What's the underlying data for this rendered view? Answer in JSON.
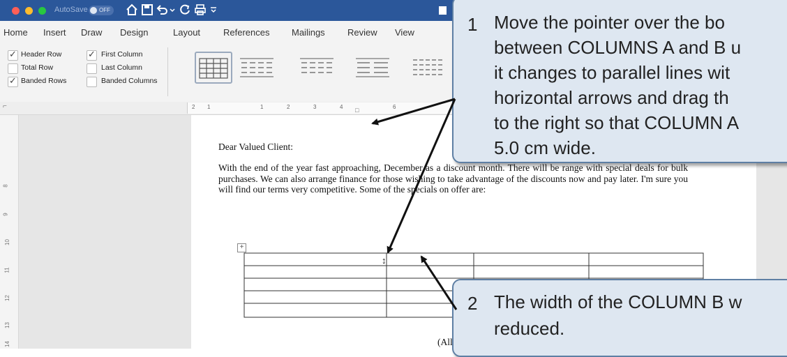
{
  "titlebar": {
    "autosave_label": "AutoSave",
    "autosave_state": "OFF"
  },
  "tabs": [
    "Home",
    "Insert",
    "Draw",
    "Design",
    "Layout",
    "References",
    "Mailings",
    "Review",
    "View"
  ],
  "options": {
    "header_row": "Header Row",
    "total_row": "Total Row",
    "banded_rows": "Banded Rows",
    "first_column": "First Column",
    "last_column": "Last Column",
    "banded_columns": "Banded Columns"
  },
  "ruler": {
    "numbers": [
      "2",
      "1",
      "1",
      "2",
      "3",
      "4",
      "6"
    ]
  },
  "vruler": {
    "numbers": [
      "8",
      "9",
      "10",
      "11",
      "12",
      "13",
      "14"
    ]
  },
  "document": {
    "salutation": "Dear Valued Client:",
    "paragraph": "With the end of the year fast approaching, December as a discount month. There will be range with special deals for bulk purchases. We can also arrange finance for those wishing to take advantage of the discounts now and pay later. I'm sure you will find our terms very competitive. Some of the specials on offer are:",
    "footer": "(All pri"
  },
  "callout1": {
    "number": "1",
    "lines": [
      "Move the pointer over the bo",
      "between COLUMNS A and B u",
      "it changes to parallel lines wit",
      "horizontal arrows and drag th",
      "to the right so that COLUMN A",
      "5.0 cm wide."
    ]
  },
  "callout2": {
    "number": "2",
    "lines": [
      "The width of the COLUMN B w",
      "reduced."
    ]
  }
}
